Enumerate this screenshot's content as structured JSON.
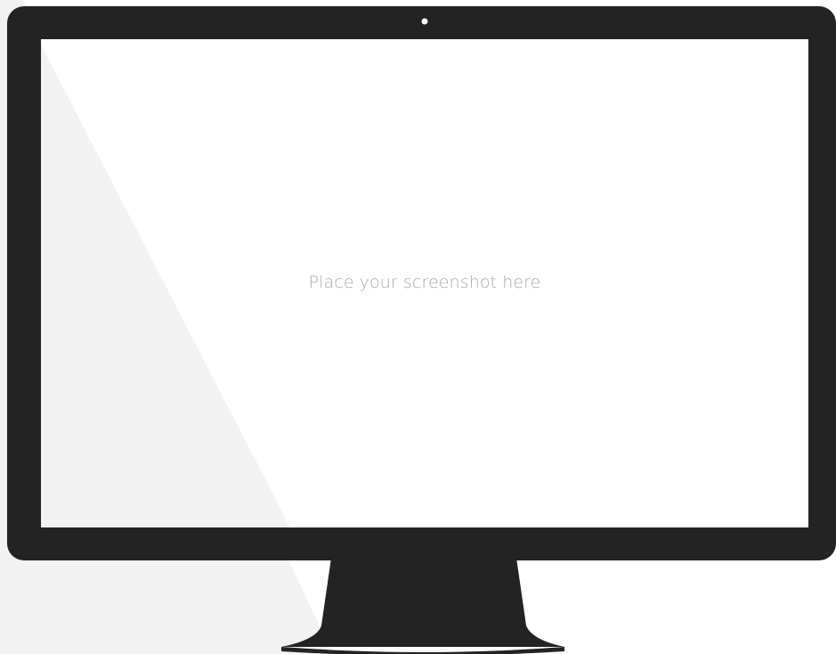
{
  "screen": {
    "placeholder_text": "Place your screenshot here"
  },
  "colors": {
    "bezel": "#232323",
    "screen": "#ffffff",
    "reflection": "#f2f2f2",
    "camera": "#ffffff",
    "placeholder_text": "#a8a8a8"
  },
  "icons": {
    "camera": "camera-icon"
  }
}
